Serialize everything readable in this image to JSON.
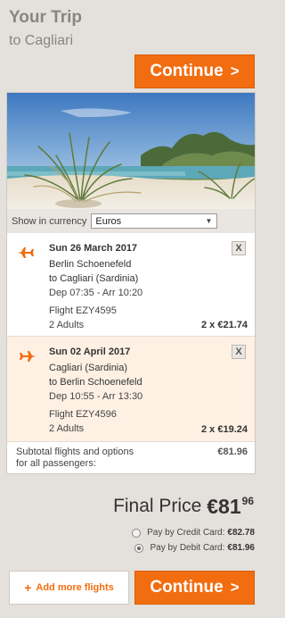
{
  "header": {
    "title": "Your Trip",
    "subtitle": "to Cagliari"
  },
  "actions": {
    "continue_label": "Continue",
    "continue_arrow": ">",
    "add_label": "Add more flights",
    "add_icon": "+"
  },
  "currency": {
    "label": "Show in currency",
    "selected": "Euros"
  },
  "flights": [
    {
      "date": "Sun 26 March 2017",
      "from": "Berlin Schoenefeld",
      "to": "to Cagliari (Sardinia)",
      "times": "Dep 07:35 - Arr 10:20",
      "flight_no": "Flight EZY4595",
      "passengers": "2 Adults",
      "price": "2 x €21.74",
      "remove": "X"
    },
    {
      "date": "Sun 02 April 2017",
      "from": "Cagliari (Sardinia)",
      "to": "to Berlin Schoenefeld",
      "times": "Dep 10:55 - Arr 13:30",
      "flight_no": "Flight EZY4596",
      "passengers": "2 Adults",
      "price": "2 x €19.24",
      "remove": "X"
    }
  ],
  "subtotal": {
    "line1": "Subtotal flights and options",
    "line2": "for all passengers:",
    "value": "€81.96"
  },
  "final_price": {
    "label": "Final Price",
    "main": "€81",
    "cents": "96"
  },
  "payment": {
    "credit_label": "Pay by Credit Card:",
    "credit_value": "€82.78",
    "debit_label": "Pay by Debit Card:",
    "debit_value": "€81.96"
  },
  "colors": {
    "accent": "#f26d10",
    "background": "#e4e0db",
    "return_highlight": "#fef1e4"
  }
}
